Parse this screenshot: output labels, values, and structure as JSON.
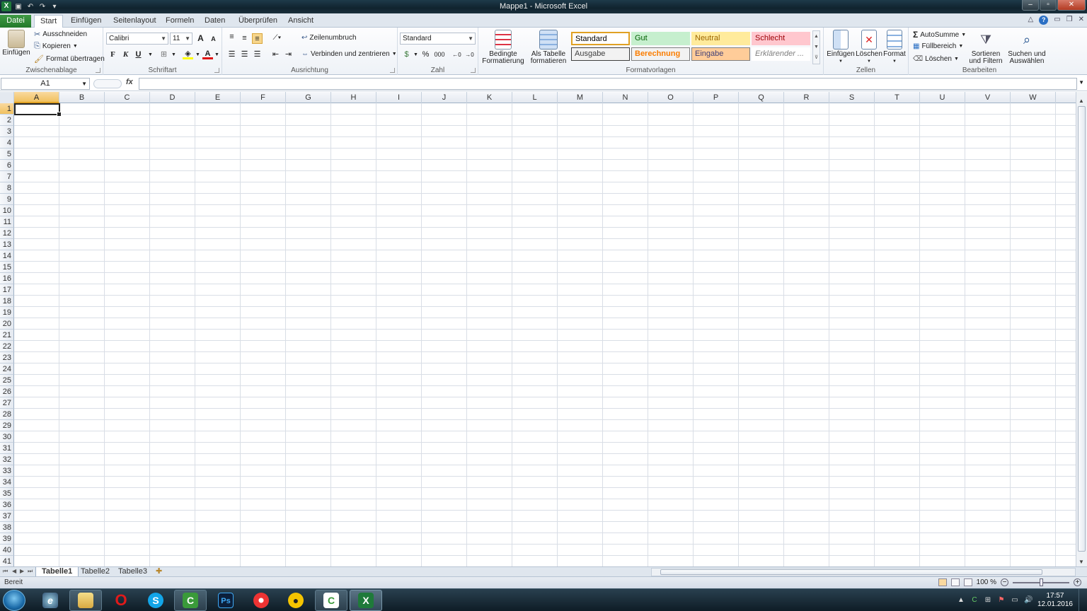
{
  "window": {
    "title": "Mappe1 - Microsoft Excel",
    "min_label": "–",
    "max_label": "▫",
    "close_label": "✕"
  },
  "ribbon_tabs": [
    "Datei",
    "Start",
    "Einfügen",
    "Seitenlayout",
    "Formeln",
    "Daten",
    "Überprüfen",
    "Ansicht"
  ],
  "active_tab": "Start",
  "clipboard": {
    "paste": "Einfügen",
    "cut": "Ausschneiden",
    "copy": "Kopieren",
    "format_painter": "Format übertragen",
    "label": "Zwischenablage"
  },
  "font": {
    "name": "Calibri",
    "size": "11",
    "grow": "A",
    "shrink": "A",
    "bold": "F",
    "italic": "K",
    "underline": "U",
    "label": "Schriftart"
  },
  "alignment": {
    "wrap": "Zeilenumbruch",
    "merge": "Verbinden und zentrieren",
    "label": "Ausrichtung"
  },
  "number": {
    "format": "Standard",
    "percent": "%",
    "thousands": "000",
    "label": "Zahl"
  },
  "styles": {
    "conditional": "Bedingte Formatierung",
    "as_table": "Als Tabelle formatieren",
    "label": "Formatvorlagen",
    "cells": [
      {
        "name": "Standard",
        "bg": "#ffffff",
        "fg": "#000000",
        "border": "#e0a123"
      },
      {
        "name": "Gut",
        "bg": "#c6efce",
        "fg": "#006100",
        "border": "#c6efce"
      },
      {
        "name": "Neutral",
        "bg": "#ffeb9c",
        "fg": "#9c6500",
        "border": "#ffeb9c"
      },
      {
        "name": "Schlecht",
        "bg": "#ffc7ce",
        "fg": "#9c0006",
        "border": "#ffc7ce"
      },
      {
        "name": "Ausgabe",
        "bg": "#f2f2f2",
        "fg": "#3f3f3f",
        "border": "#3f3f3f"
      },
      {
        "name": "Berechnung",
        "bg": "#f2f2f2",
        "fg": "#fa7d00",
        "border": "#7f7f7f"
      },
      {
        "name": "Eingabe",
        "bg": "#ffcc99",
        "fg": "#3f3f76",
        "border": "#7f7f7f"
      },
      {
        "name": "Erklärender ...",
        "bg": "#ffffff",
        "fg": "#7f7f7f",
        "border": "#ffffff"
      }
    ]
  },
  "cells_group": {
    "insert": "Einfügen",
    "delete": "Löschen",
    "format": "Format",
    "label": "Zellen"
  },
  "editing": {
    "autosum": "AutoSumme",
    "fill": "Füllbereich",
    "clear": "Löschen",
    "sort": "Sortieren und Filtern",
    "find": "Suchen und Auswählen",
    "label": "Bearbeiten"
  },
  "formula_bar": {
    "name_box": "A1",
    "fx": "fx",
    "value": ""
  },
  "columns": [
    "A",
    "B",
    "C",
    "D",
    "E",
    "F",
    "G",
    "H",
    "I",
    "J",
    "K",
    "L",
    "M",
    "N",
    "O",
    "P",
    "Q",
    "R",
    "S",
    "T",
    "U",
    "V",
    "W"
  ],
  "rows": [
    "1",
    "2",
    "3",
    "4",
    "5",
    "6",
    "7",
    "8",
    "9",
    "10",
    "11",
    "12",
    "13",
    "14",
    "15",
    "16",
    "17",
    "18",
    "19",
    "20",
    "21",
    "22",
    "23",
    "24",
    "25",
    "26",
    "27",
    "28",
    "29",
    "30",
    "31",
    "32",
    "33",
    "34",
    "35",
    "36",
    "37",
    "38",
    "39",
    "40",
    "41"
  ],
  "sheets": [
    "Tabelle1",
    "Tabelle2",
    "Tabelle3"
  ],
  "active_sheet": "Tabelle1",
  "status": {
    "ready": "Bereit",
    "zoom": "100 %"
  },
  "taskbar": {
    "apps": [
      "Internet Explorer",
      "Windows Explorer",
      "Opera",
      "Skype",
      "Camtasia",
      "Photoshop",
      "Media Player",
      "CyberGhost",
      "Camtasia Studio",
      "Microsoft Excel"
    ],
    "time": "17:57",
    "date": "12.01.2016"
  }
}
